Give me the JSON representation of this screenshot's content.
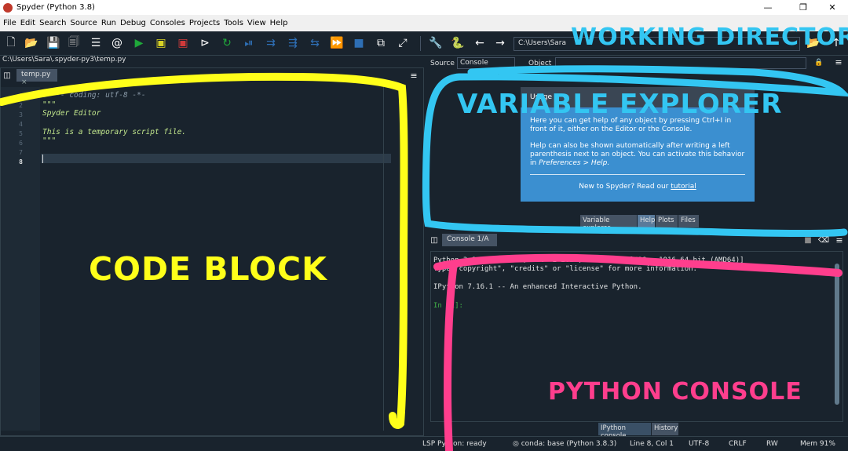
{
  "window": {
    "title": "Spyder (Python 3.8)",
    "minimize": "—",
    "maximize": "❐",
    "close": "✕"
  },
  "menu": [
    "File",
    "Edit",
    "Search",
    "Source",
    "Run",
    "Debug",
    "Consoles",
    "Projects",
    "Tools",
    "View",
    "Help"
  ],
  "toolbar": {
    "working_directory": "C:\\Users\\Sara",
    "icons": [
      "new-file-icon",
      "open-folder-icon",
      "save-icon",
      "save-all-icon",
      "outline-icon",
      "at-icon",
      "run-icon",
      "run-cell-icon",
      "run-cell-advance-icon",
      "run-selection-icon",
      "rerun-icon",
      "debug-icon",
      "step-icon",
      "step-into-icon",
      "step-return-icon",
      "continue-icon",
      "stop-icon",
      "maximize-pane-icon",
      "fullscreen-icon",
      "wrench-icon",
      "python-icon",
      "back-arrow-icon",
      "forward-arrow-icon",
      "browse-folder-icon",
      "parent-dir-icon"
    ]
  },
  "editor": {
    "file_path": "C:\\Users\\Sara\\.spyder-py3\\temp.py",
    "tab": "temp.py",
    "line_numbers": [
      "1",
      "2",
      "3",
      "4",
      "5",
      "6",
      "7",
      "8"
    ],
    "lines": [
      "# -*- coding: utf-8 -*-",
      "\"\"\"",
      "Spyder Editor",
      "",
      "This is a temporary script file.",
      "\"\"\"",
      "",
      ""
    ]
  },
  "help": {
    "source_label": "Source",
    "source_value": "Console",
    "object_label": "Object",
    "header": "Usage",
    "para1": "Here you can get help of any object by pressing Ctrl+I in front of it, either on the Editor or the Console.",
    "para2a": "Help can also be shown automatically after writing a left parenthesis next to an object. You can activate this behavior in",
    "para2b": "Preferences > Help.",
    "footer_prefix": "New to Spyder? Read our ",
    "footer_link": "tutorial",
    "tabs": [
      "Variable explorer",
      "Help",
      "Plots",
      "Files"
    ]
  },
  "console": {
    "tab": "Console 1/A",
    "lines": [
      "Python 3.8.3 (default, Jul  2 2020, 17:30:36) [MSC v.1916 64 bit (AMD64)]",
      "Type \"copyright\", \"credits\" or \"license\" for more information.",
      "",
      "IPython 7.16.1 -- An enhanced Interactive Python.",
      "",
      "In [1]:"
    ],
    "bottom_tabs": [
      "IPython console",
      "History"
    ]
  },
  "statusbar": {
    "lsp": "LSP Python: ready",
    "conda": "conda: base (Python 3.8.3)",
    "position": "Line 8, Col 1",
    "encoding": "UTF-8",
    "eol": "CRLF",
    "perm": "RW",
    "mem": "Mem 91%"
  },
  "annotations": {
    "working_directory": "WORKING DIRECTORY",
    "variable_explorer": "VARIABLE EXPLORER",
    "code_block": "CODE BLOCK",
    "python_console": "PYTHON CONSOLE"
  },
  "colors": {
    "yellow": "#ffff1a",
    "blue": "#33c6f2",
    "pink": "#ff3e8d",
    "background": "#19232d"
  }
}
